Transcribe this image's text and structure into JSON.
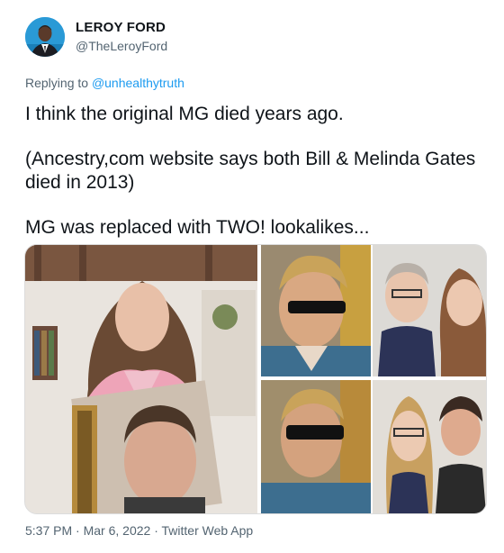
{
  "author": {
    "display_name": "LEROY FORD",
    "handle": "@TheLeroyFord"
  },
  "reply": {
    "prefix": "Replying to",
    "mention": "@unhealthytruth"
  },
  "tweet_text": {
    "line1": "I think the original MG died years ago.",
    "line2": "(Ancestry,com website says both Bill & Melinda Gates died in 2013)",
    "line3": "MG was replaced with TWO! lookalikes..."
  },
  "media": {
    "description_icons": [
      "photo-collage"
    ],
    "colors": {
      "left_bg": "#8a6a52",
      "pink_top": "#e8a6b6",
      "bookcase": "#6b4a3a",
      "frame_gold": "#b58a3c",
      "shirt_blue": "#3d6e8f",
      "sweater_navy": "#2c3357"
    }
  },
  "footer": {
    "time": "5:37 PM",
    "separator": "·",
    "date": "Mar 6, 2022",
    "client": "Twitter Web App"
  }
}
